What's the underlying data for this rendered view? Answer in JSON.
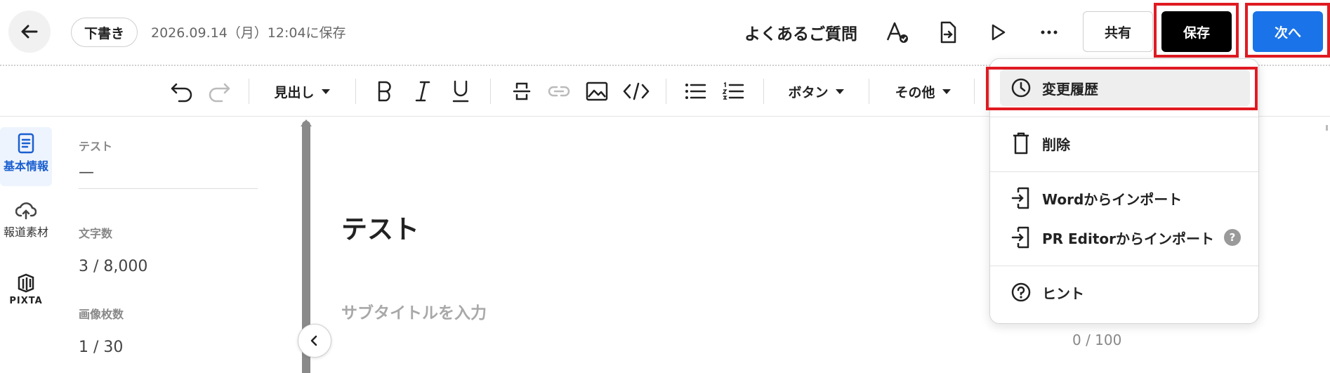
{
  "header": {
    "draft_badge": "下書き",
    "saved_at": "2026.09.14（月）12:04に保存",
    "doc_title": "よくあるご質問",
    "icons": [
      "back-arrow-icon",
      "font-check-icon",
      "export-doc-icon",
      "play-icon",
      "more-icon"
    ],
    "share_label": "共有",
    "save_label": "保存",
    "next_label": "次へ",
    "colors": {
      "save_bg": "#000000",
      "next_bg": "#1a73e8",
      "highlight": "#e01a22"
    }
  },
  "toolbar": {
    "heading_label": "見出し",
    "button_label": "ボタン",
    "other_label": "その他",
    "icons": [
      "undo-icon",
      "redo-icon",
      "bold-icon",
      "italic-icon",
      "underline-icon",
      "divider-icon",
      "link-icon",
      "image-icon",
      "code-icon",
      "bullet-list-icon",
      "numbered-list-icon"
    ]
  },
  "leftnav": {
    "items": [
      {
        "label": "基本情報",
        "icon": "document-icon",
        "active": true
      },
      {
        "label": "報道素材",
        "icon": "upload-cloud-icon",
        "active": false
      },
      {
        "label": "PIXTA",
        "icon": "pixta-logo-icon",
        "active": false
      }
    ]
  },
  "info": {
    "title_value": "テスト",
    "title_dash": "—",
    "char_count_label": "文字数",
    "char_count_value": "3 / 8,000",
    "image_count_label": "画像枚数",
    "image_count_value": "1 / 30"
  },
  "editor": {
    "title": "テスト",
    "subtitle_placeholder": "サブタイトルを入力",
    "subtitle_count": "0 / 100"
  },
  "menu": {
    "items": [
      {
        "label": "変更履歴",
        "icon": "history-clock-icon"
      },
      {
        "label": "削除",
        "icon": "trash-icon"
      },
      {
        "label": "Wordからインポート",
        "icon": "import-icon"
      },
      {
        "label": "PR Editorからインポート",
        "icon": "import-icon"
      },
      {
        "label": "ヒント",
        "icon": "help-circle-icon"
      }
    ],
    "help_glyph": "?"
  }
}
